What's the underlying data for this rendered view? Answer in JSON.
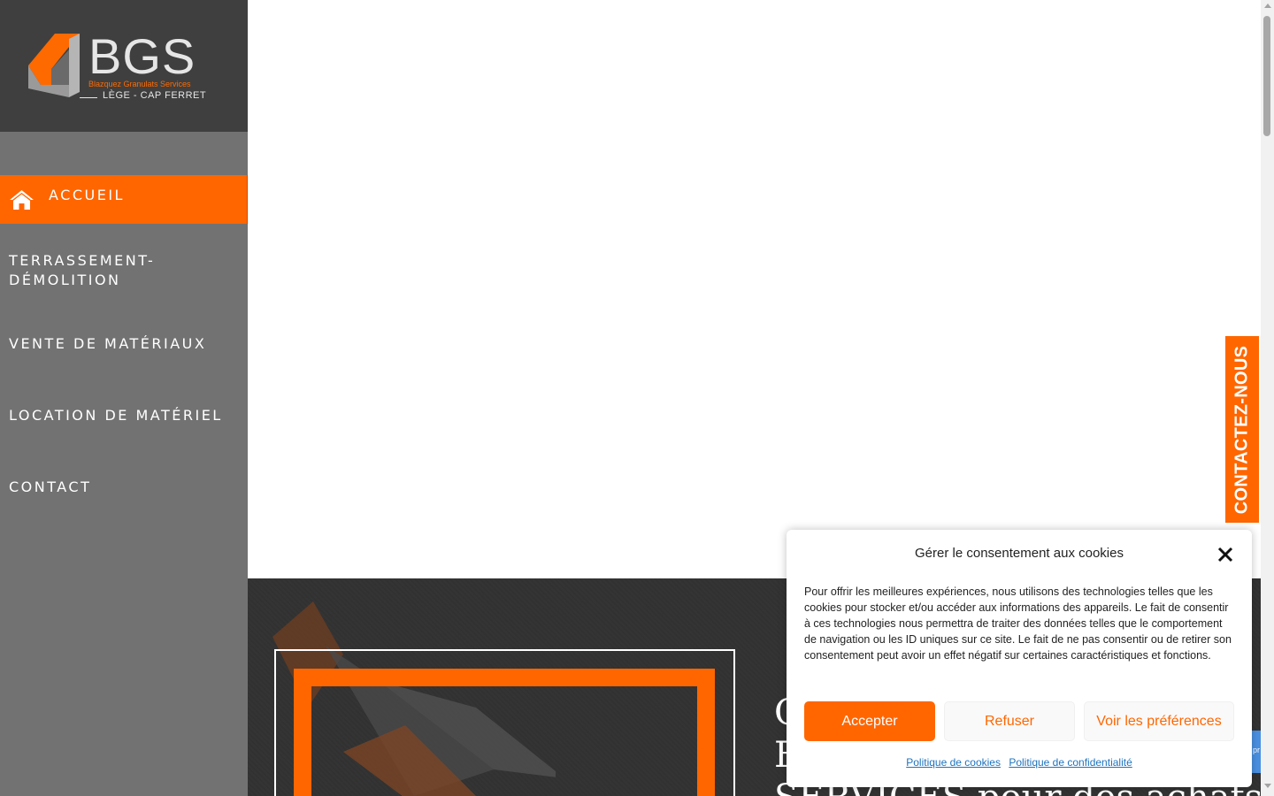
{
  "logo": {
    "name": "BGS",
    "subtitle": "Blazquez Granulats Services",
    "location": "LÈGE - CAP FERRET"
  },
  "nav": {
    "items": [
      {
        "label": "ACCUEIL",
        "icon": "home-icon",
        "active": true
      },
      {
        "label": "TERRASSEMENT-",
        "label2": "DÉMOLITION"
      },
      {
        "label": "VENTE DE MATÉRIAUX"
      },
      {
        "label": "LOCATION DE MATÉRIEL"
      },
      {
        "label": "CONTACT"
      }
    ]
  },
  "hero": {
    "lines": [
      "C",
      "B",
      "SERVICES pour des achats de"
    ]
  },
  "contact_tab": {
    "label": "CONTACTEZ-NOUS"
  },
  "recaptcha": {
    "text": "pr"
  },
  "cookie": {
    "title": "Gérer le consentement aux cookies",
    "body": "Pour offrir les meilleures expériences, nous utilisons des technologies telles que les cookies pour stocker et/ou accéder aux informations des appareils. Le fait de consentir à ces technologies nous permettra de traiter des données telles que le comportement de navigation ou les ID uniques sur ce site. Le fait de ne pas consentir ou de retirer son consentement peut avoir un effet négatif sur certaines caractéristiques et fonctions.",
    "accept": "Accepter",
    "refuse": "Refuser",
    "preferences": "Voir les préférences",
    "cookie_policy": "Politique de cookies",
    "privacy_policy": "Politique de confidentialité"
  },
  "colors": {
    "accent": "#ff6600",
    "sidebar": "#727272",
    "logo_bg": "#3f3f3f",
    "dark_section": "#333333",
    "link": "#1e73be"
  }
}
